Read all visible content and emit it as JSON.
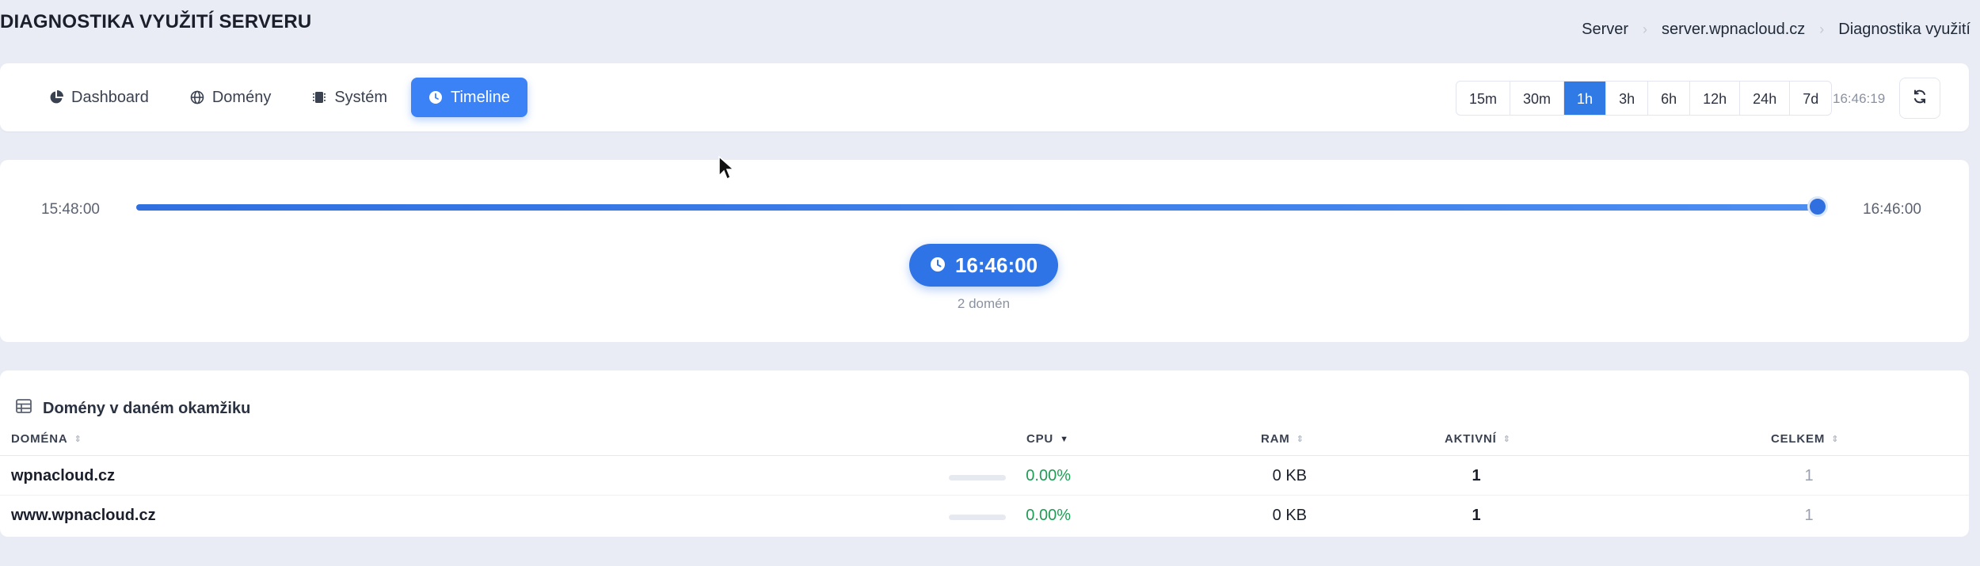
{
  "header": {
    "title": "DIAGNOSTIKA VYUŽITÍ SERVERU",
    "breadcrumb": [
      "Server",
      "server.wpnacloud.cz",
      "Diagnostika využití"
    ]
  },
  "tabs": [
    {
      "label": "Dashboard",
      "icon": "pie-chart-icon",
      "active": false
    },
    {
      "label": "Domény",
      "icon": "globe-icon",
      "active": false
    },
    {
      "label": "Systém",
      "icon": "chip-icon",
      "active": false
    },
    {
      "label": "Timeline",
      "icon": "clock-icon",
      "active": true
    }
  ],
  "time_ranges": {
    "options": [
      "15m",
      "30m",
      "1h",
      "3h",
      "6h",
      "12h",
      "24h",
      "7d"
    ],
    "selected": "1h",
    "current_time": "16:46:19"
  },
  "timeline": {
    "start": "15:48:00",
    "end": "16:46:00",
    "selected_time": "16:46:00",
    "domain_count": "2 domén",
    "position_fraction": 1.0
  },
  "domains_table": {
    "title": "Domény v daném okamžiku",
    "columns": [
      "DOMÉNA",
      "CPU",
      "RAM",
      "AKTIVNÍ",
      "CELKEM"
    ],
    "rows": [
      {
        "domain": "wpnacloud.cz",
        "cpu": "0.00%",
        "ram": "0 KB",
        "active": "1",
        "total": "1"
      },
      {
        "domain": "www.wpnacloud.cz",
        "cpu": "0.00%",
        "ram": "0 KB",
        "active": "1",
        "total": "1"
      }
    ]
  },
  "colors": {
    "accent": "#3b82f6",
    "background": "#e9ecf4",
    "cpu_value": "#1f9d55"
  }
}
